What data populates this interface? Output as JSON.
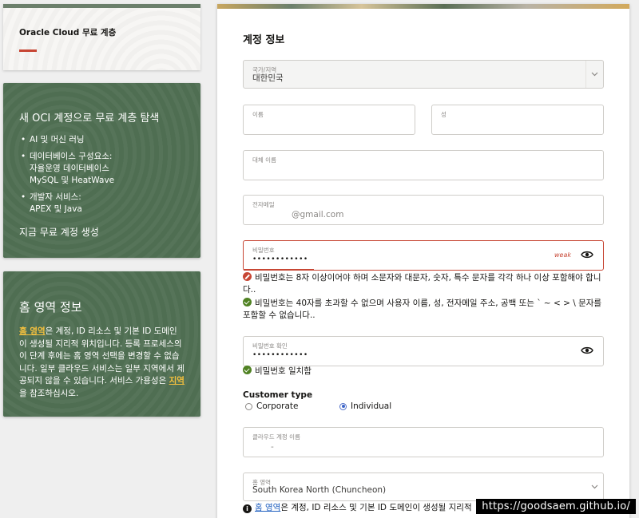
{
  "left": {
    "title": "Oracle Cloud 무료 계층",
    "promo": {
      "heading": "새 OCI 계정으로 무료 계층 탐색",
      "items": [
        {
          "l1": "AI 및 머신 러닝",
          "l2": "",
          "l3": ""
        },
        {
          "l1": "데이터베이스 구성요소:",
          "l2": "자율운영 데이터베이스",
          "l3": "MySQL 및 HeatWave"
        },
        {
          "l1": "개발자 서비스:",
          "l2": "APEX 및 Java",
          "l3": ""
        }
      ],
      "cta": "지금 무료 계정 생성"
    },
    "home": {
      "heading": "홈 영역 정보",
      "link1": "홈 영역",
      "text1": "은 계정, ID 리소스 및 기본 ID 도메인이 생성될 지리적 위치입니다. 등록 프로세스의 이 단계 후에는 홈 영역 선택을 변경할 수 없습니다. 일부 클라우드 서비스는 일부 지역에서 제공되지 않을 수 있습니다. 서비스 가용성은 ",
      "link2": "지역",
      "text2": "을 참조하십시오."
    }
  },
  "form": {
    "section_title": "계정 정보",
    "country": {
      "label": "국가/지역",
      "value": "대한민국"
    },
    "first_name": {
      "label": "이름",
      "value": ""
    },
    "last_name": {
      "label": "성",
      "value": ""
    },
    "alt_name": {
      "label": "대체 이름",
      "value": ""
    },
    "email": {
      "label": "전자메일",
      "value": "@gmail.com"
    },
    "password": {
      "label": "비밀번호",
      "value": "••••••••••••",
      "strength": "weak"
    },
    "pw_msg1": "비밀번호는 8자 이상이어야 하며 소문자와 대문자, 숫자, 특수 문자를 각각 하나 이상 포함해야 합니다..",
    "pw_msg2": "비밀번호는 40자를 초과할 수 없으며 사용자 이름, 성, 전자메일 주소, 공백 또는 ` ~ < > \\ 문자를 포함할 수 없습니다..",
    "confirm": {
      "label": "비밀번호 확인",
      "value": "••••••••••••"
    },
    "match_msg": "비밀번호 일치함",
    "customer_type": {
      "label": "Customer type",
      "options": [
        "Corporate",
        "Individual"
      ],
      "selected": "Individual"
    },
    "cloud_account": {
      "label": "클라우드 계정 이름",
      "value": "-"
    },
    "home_region": {
      "label": "홈 영역",
      "value": "South Korea North (Chuncheon)"
    },
    "home_note_link": "홈 영역",
    "home_note_text": "은 계정, ID 리소스 및 기본 ID 도메인이 생성될 지리적"
  },
  "watermark": "https://goodsaem.github.io/"
}
